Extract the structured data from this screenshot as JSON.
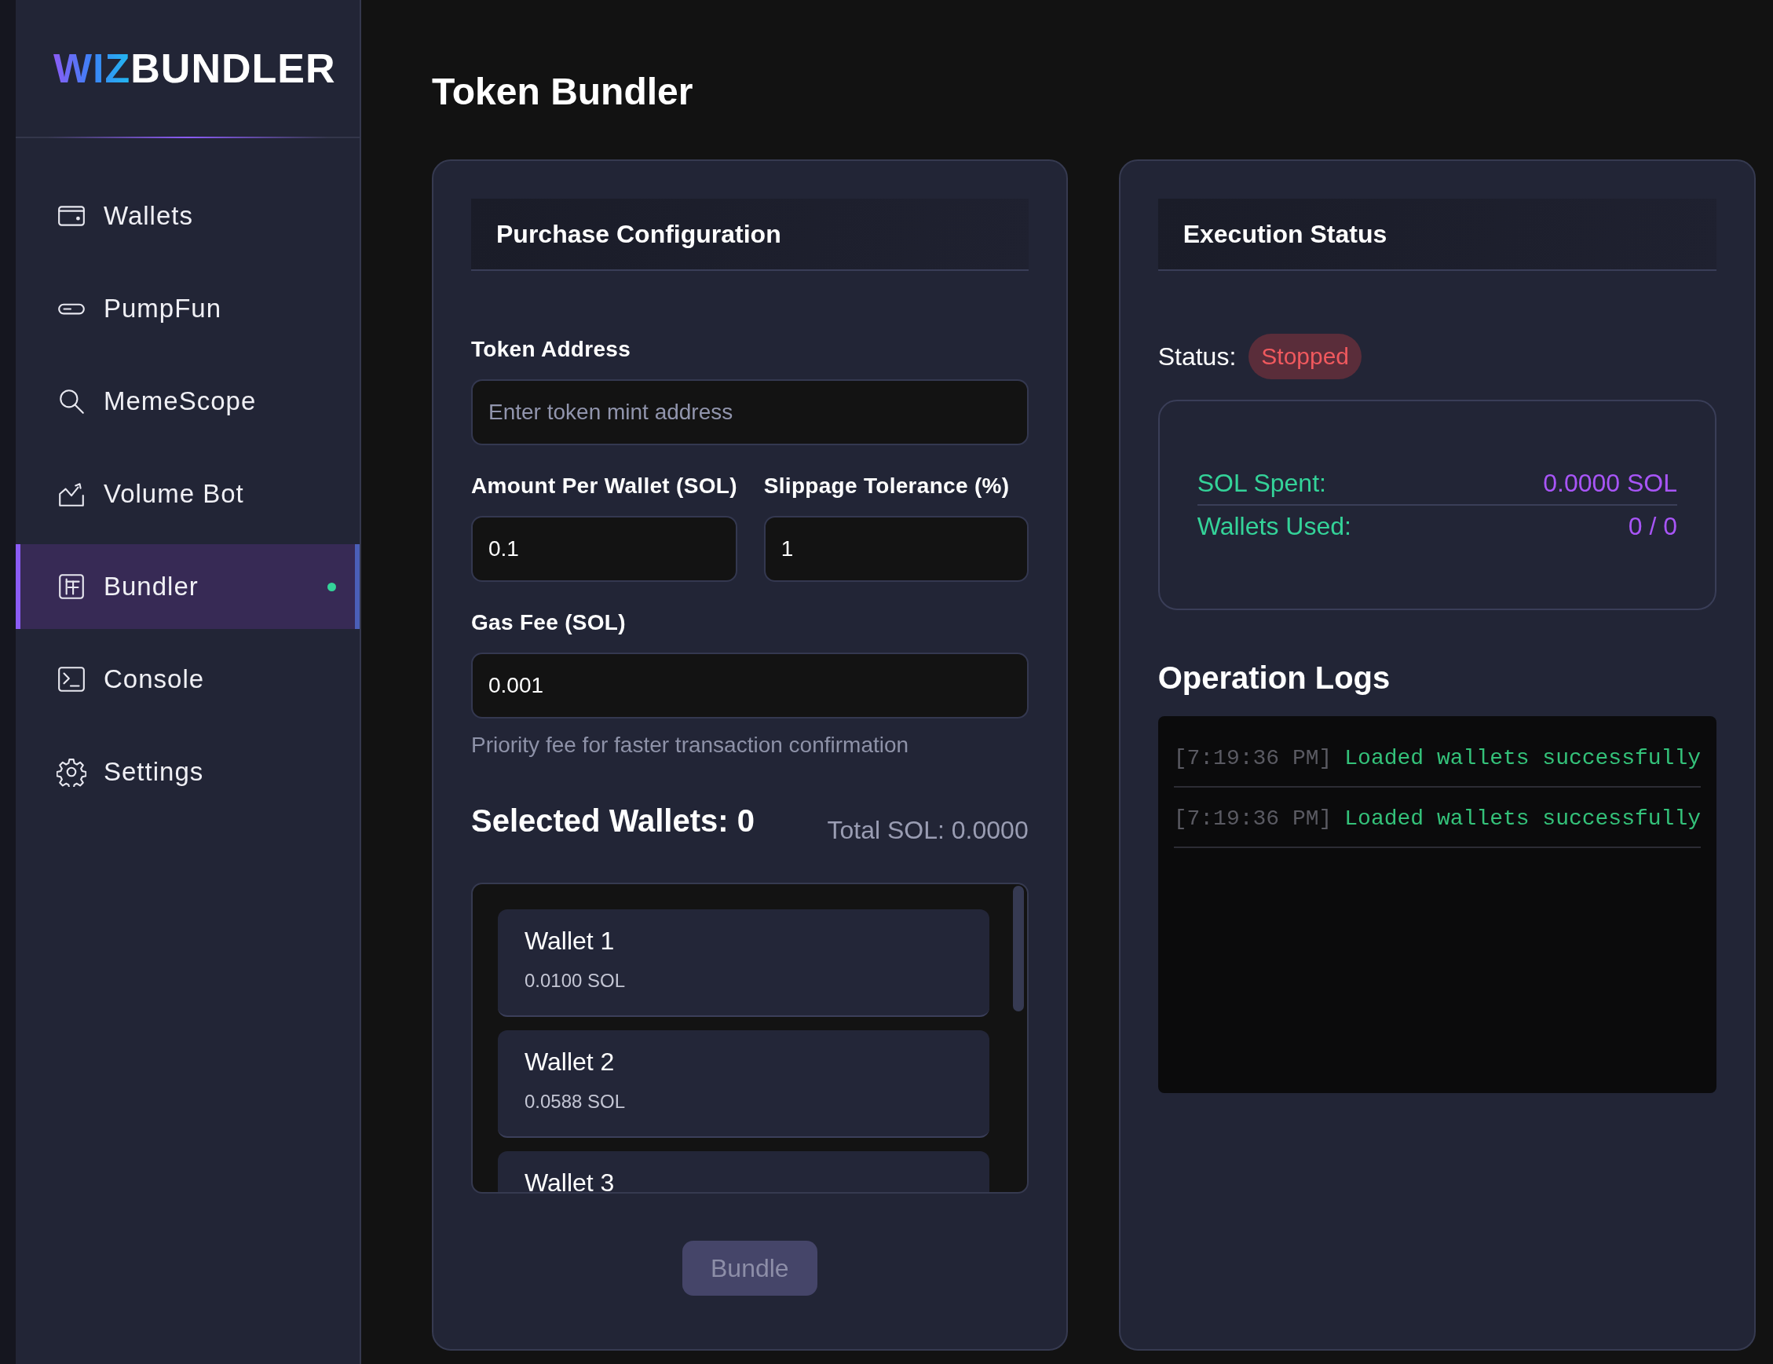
{
  "brand": {
    "part_1": "WIZ",
    "part_2": "BUNDLER"
  },
  "sidebar": {
    "items": [
      {
        "label": "Wallets",
        "selected": false
      },
      {
        "label": "PumpFun",
        "selected": false
      },
      {
        "label": "MemeScope",
        "selected": false
      },
      {
        "label": "Volume Bot",
        "selected": false
      },
      {
        "label": "Bundler",
        "selected": true
      },
      {
        "label": "Console",
        "selected": false
      },
      {
        "label": "Settings",
        "selected": false
      }
    ]
  },
  "page": {
    "title": "Token Bundler"
  },
  "purchase_panel": {
    "title": "Purchase Configuration",
    "rows": [
      {
        "fields": [
          {
            "label": "Token Address",
            "placeholder": "Enter token mint address"
          }
        ]
      },
      {
        "fields": [
          {
            "label": "Amount Per Wallet (SOL)",
            "value": "0.1"
          },
          {
            "label": "Slippage Tolerance (%)",
            "value": "1"
          }
        ]
      },
      {
        "fields": [
          {
            "label": "Gas Fee (SOL)",
            "value": "0.001",
            "help": "Priority fee for faster transaction confirmation"
          }
        ]
      }
    ],
    "selected_wallets": "Selected Wallets: 0",
    "total_sol": "Total SOL: 0.0000",
    "wallets": [
      {
        "name": "Wallet 1",
        "balance": "0.0100 SOL"
      },
      {
        "name": "Wallet 2",
        "balance": "0.0588 SOL"
      },
      {
        "name": "Wallet 3"
      }
    ],
    "bundle_button": {
      "label": "Bundle",
      "disabled": true
    }
  },
  "execution_panel": {
    "title": "Execution Status",
    "status_label": "Status:",
    "status": "Stopped",
    "stats": [
      {
        "label": "SOL Spent:",
        "value": "0.0000 SOL"
      },
      {
        "label": "Wallets Used:",
        "value": "0 / 0"
      }
    ],
    "logs_title": "Operation Logs",
    "logs": [
      {
        "time": "[7:19:36 PM]",
        "message": "Loaded wallets successfully"
      },
      {
        "time": "[7:19:36 PM]",
        "message": "Loaded wallets successfully"
      }
    ]
  }
}
